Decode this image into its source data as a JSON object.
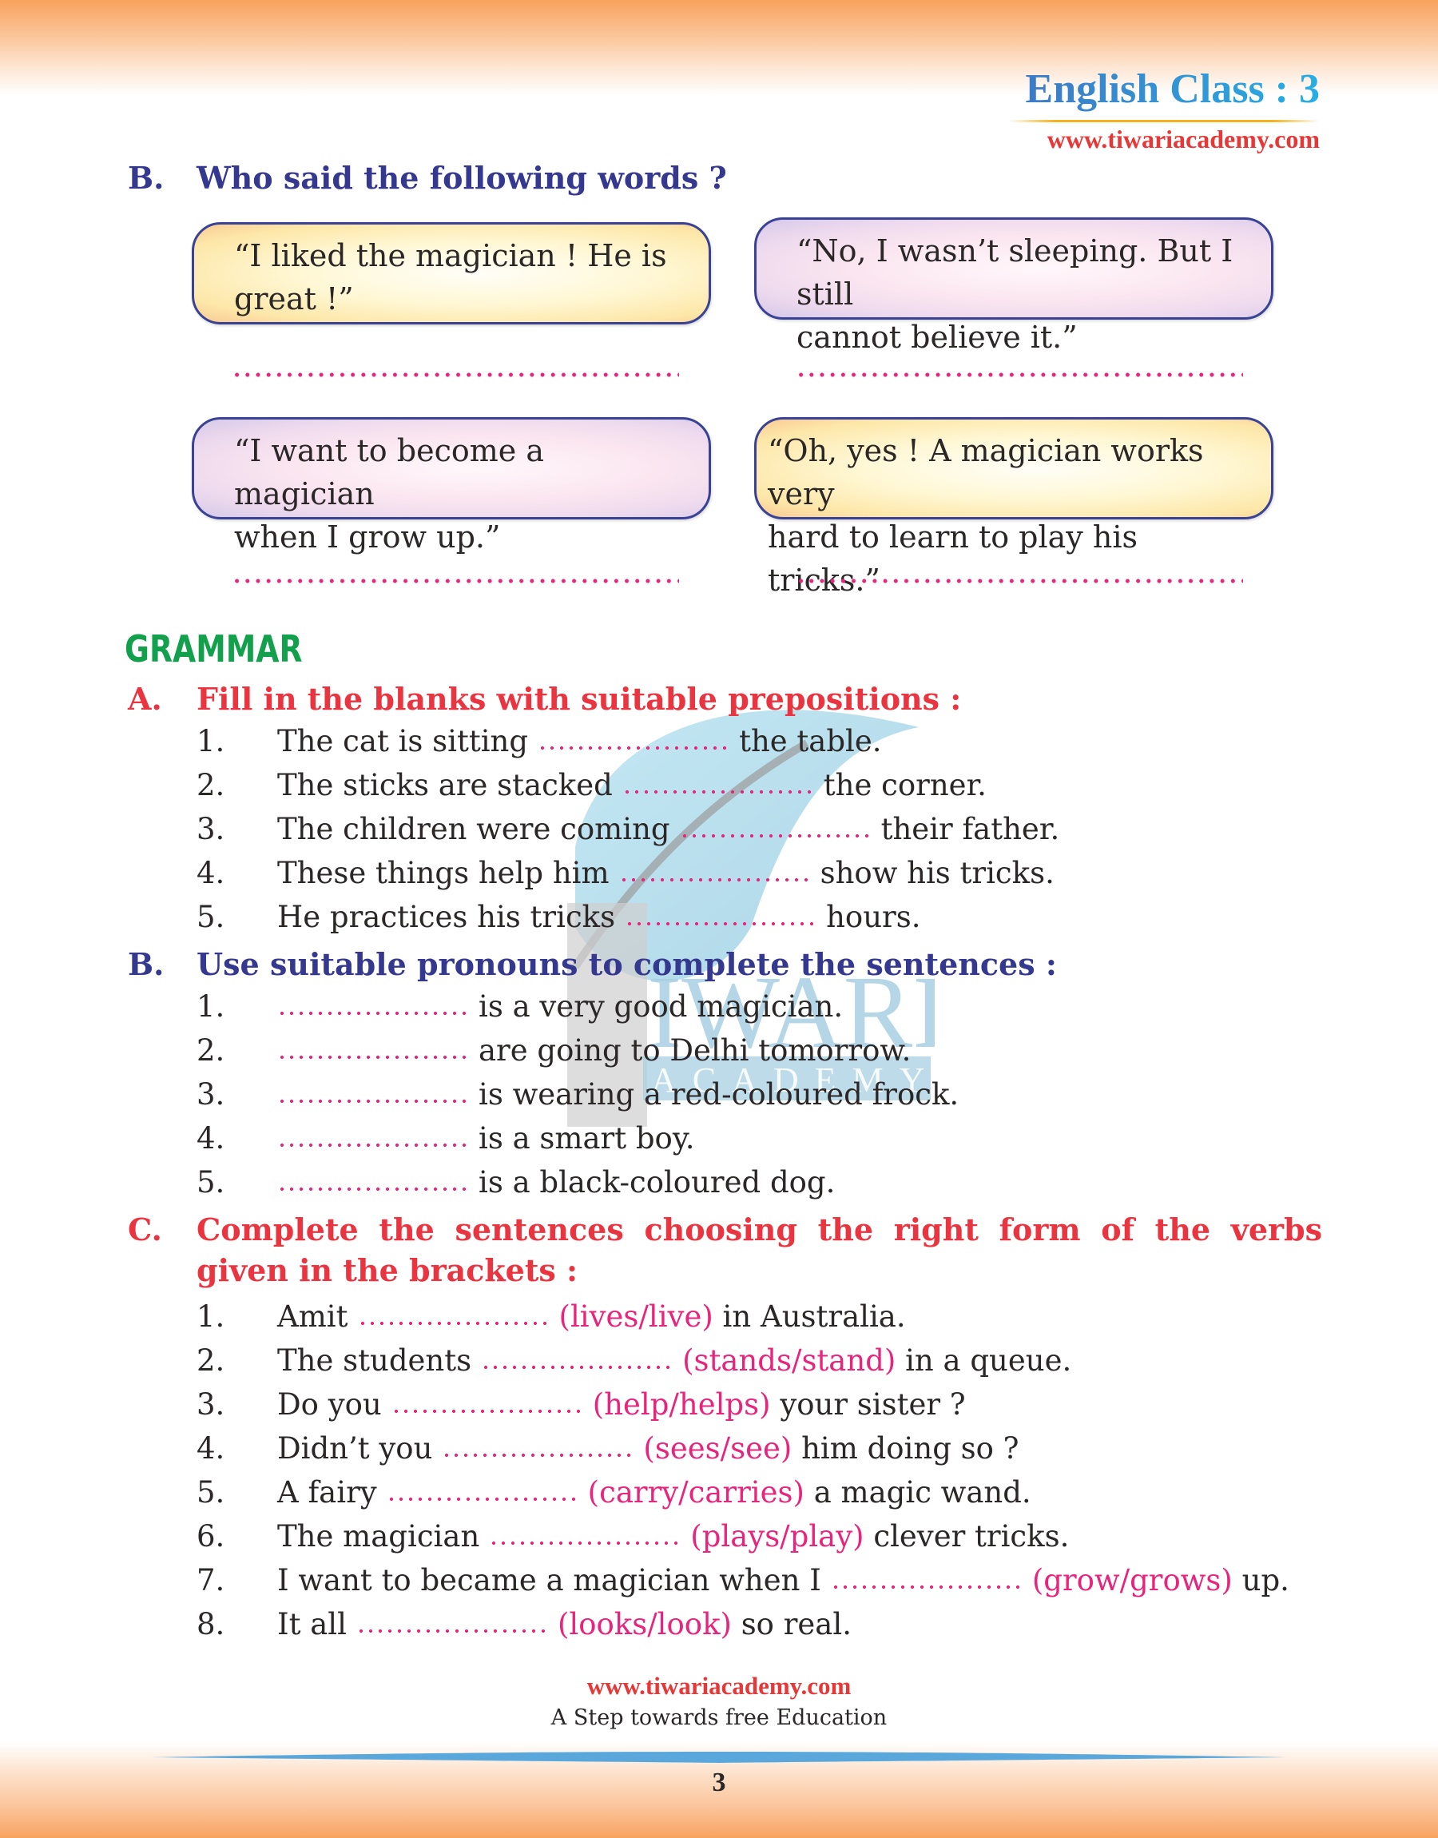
{
  "header": {
    "title": "English Class : 3",
    "url": "www.tiwariacademy.com"
  },
  "section_b_dialogue": {
    "letter": "B.",
    "heading": "Who said the following words ?",
    "quotes": [
      {
        "line1": "“I liked the magician ! He is",
        "line2": "great !”",
        "answer": ""
      },
      {
        "line1": "“No, I wasn’t sleeping. But I still",
        "line2": "cannot believe it.”",
        "answer": ""
      },
      {
        "line1": "“I want to become a magician",
        "line2": "when I grow up.”",
        "answer": ""
      },
      {
        "line1": "“Oh, yes ! A magician works very",
        "line2": "hard to learn to play his tricks.”",
        "answer": ""
      }
    ]
  },
  "grammar": {
    "title": "GRAMMAR",
    "exercise_a": {
      "letter": "A.",
      "heading": "Fill in the blanks with suitable prepositions :",
      "items": [
        {
          "num": "1.",
          "before": "The cat is sitting",
          "after": "the table."
        },
        {
          "num": "2.",
          "before": "The sticks are stacked",
          "after": "the corner."
        },
        {
          "num": "3.",
          "before": "The children were coming",
          "after": "their father."
        },
        {
          "num": "4.",
          "before": "These things help him",
          "after": "show his tricks."
        },
        {
          "num": "5.",
          "before": "He practices his tricks",
          "after": "hours."
        }
      ]
    },
    "exercise_b": {
      "letter": "B.",
      "heading": "Use suitable pronouns to complete the sentences :",
      "items": [
        {
          "num": "1.",
          "after": "is a very good magician."
        },
        {
          "num": "2.",
          "after": "are going to Delhi tomorrow."
        },
        {
          "num": "3.",
          "after": "is wearing a red-coloured frock."
        },
        {
          "num": "4.",
          "after": "is a smart boy."
        },
        {
          "num": "5.",
          "after": "is a black-coloured dog."
        }
      ]
    },
    "exercise_c": {
      "letter": "C.",
      "heading_line1": "Complete the sentences choosing the right form of the verbs",
      "heading_line2": "given in the brackets :",
      "items": [
        {
          "num": "1.",
          "before": "Amit",
          "hint": "(lives/live)",
          "after": "in Australia."
        },
        {
          "num": "2.",
          "before": "The students",
          "hint": "(stands/stand)",
          "after": "in a queue."
        },
        {
          "num": "3.",
          "before": "Do you",
          "hint": "(help/helps)",
          "after": "your sister ?"
        },
        {
          "num": "4.",
          "before": "Didn’t you",
          "hint": "(sees/see)",
          "after": "him doing so ?"
        },
        {
          "num": "5.",
          "before": "A fairy",
          "hint": "(carry/carries)",
          "after": "a magic wand."
        },
        {
          "num": "6.",
          "before": "The magician",
          "hint": "(plays/play)",
          "after": "clever tricks."
        },
        {
          "num": "7.",
          "before": "I want to became a magician when I",
          "hint": "(grow/grows)",
          "after": "up."
        },
        {
          "num": "8.",
          "before": "It all",
          "hint": "(looks/look)",
          "after": "so real."
        }
      ]
    }
  },
  "watermark": {
    "word1": "IWARI",
    "word2": "ACADEMY"
  },
  "footer": {
    "url": "www.tiwariacademy.com",
    "tagline": "A Step towards free Education",
    "page_number": "3"
  },
  "colors": {
    "heading_blue": "#35388f",
    "heading_red": "#ea3540",
    "grammar_green": "#12a04c",
    "blank_pink": "#e8247c",
    "band_orange": "#f8a25c"
  }
}
